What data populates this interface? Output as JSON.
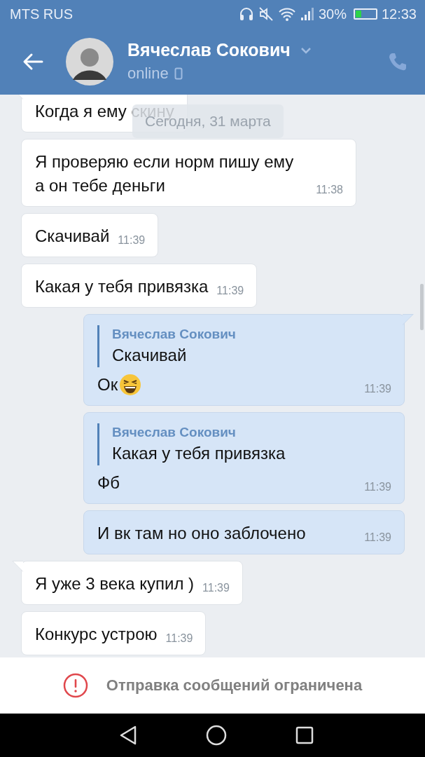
{
  "status_bar": {
    "carrier": "MTS RUS",
    "battery_percent": "30%",
    "time": "12:33"
  },
  "header": {
    "name": "Вячеслав Сокович",
    "status": "online"
  },
  "date_divider": "Сегодня, 31 марта",
  "messages": [
    {
      "kind": "incoming",
      "text": "Когда я ему скину",
      "tail": true
    },
    {
      "kind": "incoming",
      "text": "Я проверяю если норм пишу ему а он тебе деньги",
      "time": "11:38",
      "tail": false
    },
    {
      "kind": "incoming",
      "text": "Скачивай",
      "time": "11:39",
      "tail": false
    },
    {
      "kind": "incoming",
      "text": "Какая у тебя привязка",
      "time": "11:39",
      "tail": false
    },
    {
      "kind": "outgoing",
      "reply": {
        "author": "Вячеслав Сокович",
        "text": "Скачивай"
      },
      "text": "Ок",
      "emoji": true,
      "time": "11:39",
      "tail": true
    },
    {
      "kind": "outgoing",
      "reply": {
        "author": "Вячеслав Сокович",
        "text": "Какая у тебя привязка"
      },
      "text": "Фб",
      "time": "11:39",
      "tail": false
    },
    {
      "kind": "outgoing",
      "text": "И вк там но оно заблочено",
      "time": "11:39",
      "tail": false
    },
    {
      "kind": "incoming",
      "text": "Я уже 3 века купил )",
      "time": "11:39",
      "tail": true
    },
    {
      "kind": "incoming",
      "text": "Конкурс устрою",
      "time": "11:39",
      "tail": false
    }
  ],
  "notice": "Отправка сообщений ограничена"
}
